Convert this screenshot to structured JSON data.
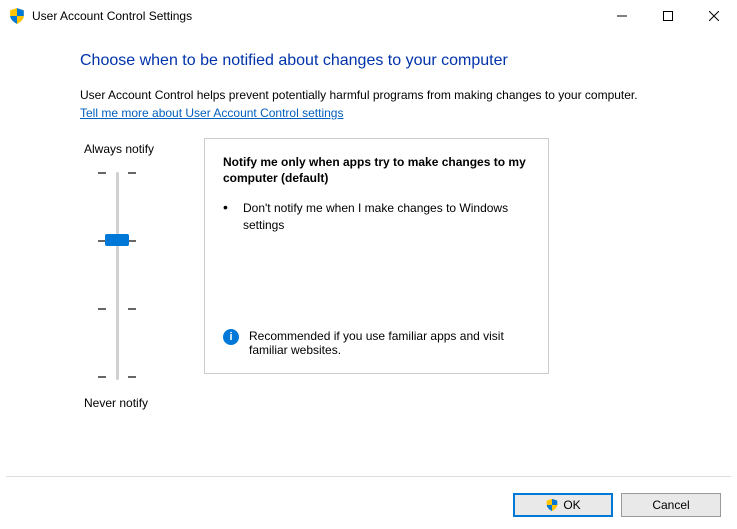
{
  "window": {
    "title": "User Account Control Settings"
  },
  "main": {
    "headline": "Choose when to be notified about changes to your computer",
    "helptext": "User Account Control helps prevent potentially harmful programs from making changes to your computer.",
    "link": "Tell me more about User Account Control settings"
  },
  "slider": {
    "top_label": "Always notify",
    "bottom_label": "Never notify",
    "levels": 4,
    "selected_index": 1
  },
  "panel": {
    "title": "Notify me only when apps try to make changes to my computer (default)",
    "bullet": "Don't notify me when I make changes to Windows settings",
    "recommendation": "Recommended if you use familiar apps and visit familiar websites."
  },
  "buttons": {
    "ok": "OK",
    "cancel": "Cancel"
  }
}
